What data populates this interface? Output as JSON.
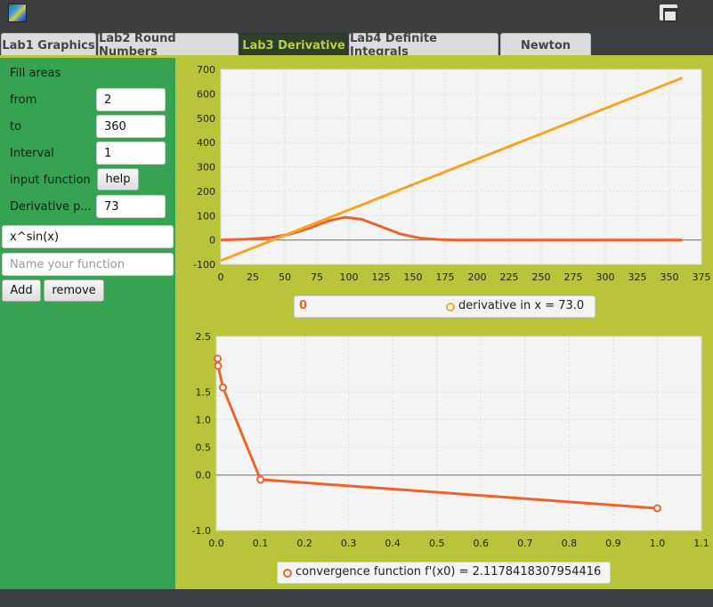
{
  "tabs": [
    {
      "label": "Lab1 Graphics",
      "active": false
    },
    {
      "label": "Lab2 Round Numbers",
      "active": false
    },
    {
      "label": "Lab3 Derivative",
      "active": true
    },
    {
      "label": "Lab4 Definite Integrals",
      "active": false
    },
    {
      "label": "Newton",
      "active": false
    }
  ],
  "sidebar": {
    "fill_areas": "Fill areas",
    "from_label": "from",
    "from_value": "2",
    "to_label": "to",
    "to_value": "360",
    "interval_label": "Interval",
    "interval_value": "1",
    "input_function_label": "input function",
    "help_label": "help",
    "derivative_label": "Derivative p...",
    "derivative_value": "73",
    "function_value": "x^sin(x)",
    "name_placeholder": "Name your function",
    "add_label": "Add",
    "remove_label": "remove"
  },
  "colors": {
    "orange": "#f5a623",
    "red_orange": "#f0622c",
    "sidebar": "#36a352",
    "content": "#b9c43b",
    "plot_bg": "#f4f4f4"
  },
  "chart_data": [
    {
      "type": "line",
      "x_ticks": [
        "0",
        "25",
        "50",
        "75",
        "100",
        "125",
        "150",
        "175",
        "200",
        "225",
        "250",
        "275",
        "300",
        "325",
        "350",
        "375"
      ],
      "y_ticks": [
        "700",
        "600",
        "500",
        "400",
        "300",
        "200",
        "100",
        "0",
        "-100"
      ],
      "xlim": [
        0,
        375
      ],
      "ylim": [
        -100,
        700
      ],
      "grid": true,
      "legend_position": "bottom",
      "series": [
        {
          "name": "",
          "color": "#f0622c",
          "x": [
            0,
            20,
            40,
            55,
            70,
            85,
            97,
            110,
            125,
            140,
            155,
            170,
            185,
            200,
            250,
            300,
            360
          ],
          "y": [
            0,
            3,
            10,
            25,
            50,
            80,
            93,
            85,
            55,
            25,
            8,
            2,
            0,
            0,
            0,
            0,
            0
          ]
        },
        {
          "name": "derivative  in x = 73.0",
          "color": "#f5a623",
          "x": [
            0,
            360
          ],
          "y": [
            -85,
            665
          ]
        }
      ],
      "legend": {
        "empty_symbol": "0",
        "label": "derivative  in x = 73.0"
      }
    },
    {
      "type": "line",
      "x_ticks": [
        "0.0",
        "0.1",
        "0.2",
        "0.3",
        "0.4",
        "0.5",
        "0.6",
        "0.7",
        "0.8",
        "0.9",
        "1.0",
        "1.1"
      ],
      "y_ticks": [
        "2.5",
        "1.5",
        "1.0",
        "0.5",
        "0.0",
        "",
        "-1.0"
      ],
      "xlim": [
        0,
        1.1
      ],
      "ylim": [
        -1.0,
        2.5
      ],
      "grid": true,
      "legend_position": "bottom",
      "series": [
        {
          "name": "convergence function  f'(x0) = 2.1178418307954416",
          "color": "#f0622c",
          "x": [
            0.003,
            0.004,
            0.015,
            0.1,
            1.0
          ],
          "y": [
            2.1,
            1.97,
            1.58,
            -0.08,
            -0.6
          ]
        }
      ]
    }
  ]
}
